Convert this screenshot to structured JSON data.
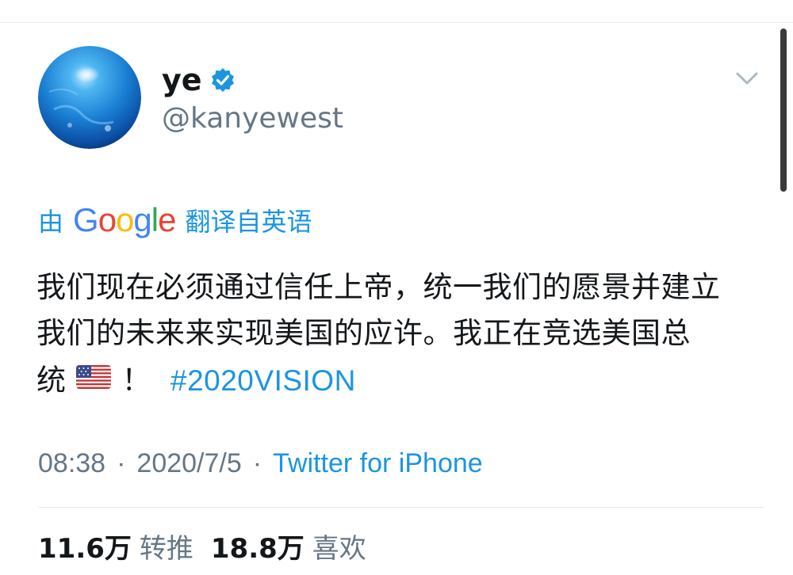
{
  "colors": {
    "accent": "#1b95e0",
    "muted_text": "#657786",
    "primary_text": "#14171a",
    "divider": "#e6ecf0"
  },
  "author": {
    "display_name": "ye",
    "handle": "@kanyewest",
    "verified_icon": "verified-badge-icon",
    "avatar_icon": "blue-globe-avatar"
  },
  "menu": {
    "icon": "chevron-down-icon"
  },
  "translation": {
    "prefix": "由",
    "provider_letters": [
      "G",
      "o",
      "o",
      "g",
      "l",
      "e"
    ],
    "suffix": "翻译自英语"
  },
  "tweet": {
    "lines": [
      "我们现在必须通过信任上帝，统一我们的愿景并建立",
      "我们的未来来实现美国的应许。我正在竞选美国总",
      "统"
    ],
    "flag_icon": "us-flag-icon",
    "exclamation": "！",
    "hashtag": "#2020VISION"
  },
  "meta": {
    "time": "08:38",
    "separator": "·",
    "date": "2020/7/5",
    "source": "Twitter for iPhone"
  },
  "stats": {
    "retweets_count": "11.6万",
    "retweets_label": "转推",
    "likes_count": "18.8万",
    "likes_label": "喜欢"
  }
}
